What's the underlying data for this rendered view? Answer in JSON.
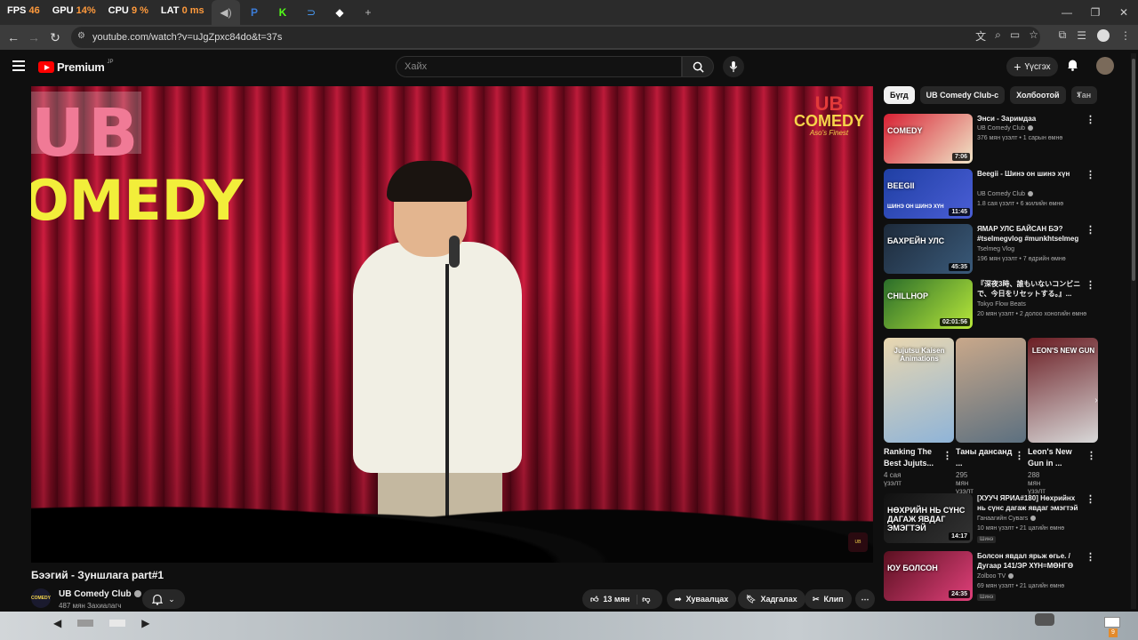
{
  "hud": {
    "fps_label": "FPS",
    "fps_value": "46",
    "gpu_label": "GPU",
    "gpu_value": "14%",
    "cpu_label": "CPU",
    "cpu_value": "9 %",
    "lat_label": "LAT",
    "lat_value": "0 ms"
  },
  "browser": {
    "url": "youtube.com/watch?v=uJgZpxc84do&t=37s",
    "new_tab": "+"
  },
  "header": {
    "logo_text": "Premium",
    "logo_region": "JP",
    "search_placeholder": "Хайх",
    "create_label": "Үүсгэх"
  },
  "video": {
    "title": "Бээгий - Зуншлага part#1",
    "channel": "UB Comedy Club",
    "subscribers": "487 мян Захиалагч",
    "likes": "13 мян",
    "share_label": "Хуваалцах",
    "save_label": "Хадгалах",
    "clip_label": "Клип",
    "stage_text_1": "UB",
    "stage_text_2": "OMEDY",
    "watermark_1": "UB",
    "watermark_2": "COMEDY",
    "watermark_3": "Aso's Finest",
    "channel_avatar_text": "COMEDY"
  },
  "chips": [
    "Бүгд",
    "UB Comedy Club-с",
    "Холбоотой",
    "Тан"
  ],
  "recommendations": [
    {
      "title": "Энси - Заримдаа",
      "channel": "UB Comedy Club",
      "meta": "376 мян үзэлт • 1 сарын өмнө",
      "duration": "7:06",
      "thumb_colors": [
        "#d82033",
        "#f0e6c8"
      ],
      "thumb_text": "COMEDY",
      "verified": true
    },
    {
      "title": "Beegii - Шинэ он шинэ хүн",
      "channel": "UB Comedy Club",
      "meta": "1.8 сая үзэлт • 6 жилийн өмнө",
      "duration": "11:45",
      "thumb_colors": [
        "#1f3fa3",
        "#4a5ed6"
      ],
      "thumb_text": "BEEGII",
      "thumb_sub": "ШИНЭ ОН ШИНЭ ХҮН",
      "verified": true
    },
    {
      "title": "ЯМАР УЛС БАЙСАН БЭ? #tselmegvlog #munkhtselmeg",
      "channel": "Tselmeg Vlog",
      "meta": "196 мян үзэлт • 7 өдрийн өмнө",
      "duration": "45:35",
      "thumb_colors": [
        "#1d2a3a",
        "#3a5a7a"
      ],
      "thumb_text": "БАХРЕЙН УЛС",
      "verified": false
    },
    {
      "title": "『深夜3時、誰もいないコンビニで、今日をリセットする。』...",
      "channel": "Tokyo Flow Beats",
      "meta": "20 мян үзэлт • 2 долоо хоногийн өмнө",
      "duration": "02:01:56",
      "thumb_colors": [
        "#2a6d2a",
        "#b8e83a"
      ],
      "thumb_text": "CHILLHOP",
      "verified": false
    }
  ],
  "shorts": [
    {
      "title": "Ranking The Best Jujuts...",
      "views": "4 сая үзэлт",
      "colors": [
        "#e9d7b0",
        "#8fb4d8"
      ],
      "label": "Jujutsu Kaisen Animations"
    },
    {
      "title": "Таны дансанд ...",
      "views": "295 мян үзэлт",
      "colors": [
        "#c9a88a",
        "#5c7080"
      ],
      "label": ""
    },
    {
      "title": "Leon's New Gun in ...",
      "views": "288 мян үзэлт",
      "colors": [
        "#6b1d23",
        "#d8d8d8"
      ],
      "label": "LEON'S NEW GUN"
    }
  ],
  "recommendations_lower": [
    {
      "title": "[ХУУЧ ЯРИА#180] Нөхрийнх нь сүнс дагаж явдаг эмэгтэй",
      "channel": "Ганаагийн Сувагs",
      "meta": "10 мян үзэлт • 21 цагийн өмнө",
      "duration": "14:17",
      "badge": "Шинэ",
      "thumb_colors": [
        "#111111",
        "#333333"
      ],
      "thumb_text": "НӨХРИЙН НЬ СҮНС ДАГАЖ ЯВДАГ ЭМЭГТЭЙ",
      "verified": true
    },
    {
      "title": "Болсон явдал ярьж өгье. / Дугаар 141/ЭР ХҮН=МӨНГӨ",
      "channel": "Zolboo TV",
      "meta": "69 мян үзэлт • 21 цагийн өмнө",
      "duration": "24:35",
      "badge": "Шинэ",
      "thumb_colors": [
        "#5a1020",
        "#e0407a"
      ],
      "thumb_text": "ЮУ БОЛСОН",
      "verified": true
    }
  ],
  "taskbar": {
    "mail_badge": "9"
  },
  "colors": {
    "accent": "#ff0000",
    "background": "#0f0f0f",
    "chip_bg": "#272727"
  }
}
